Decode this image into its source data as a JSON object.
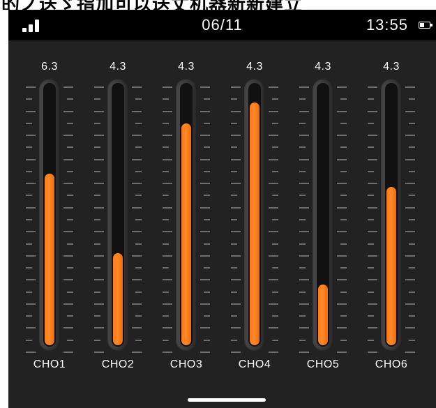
{
  "banner": {
    "text": "的ノ送ゞ指加可以送丈机器新新建立"
  },
  "status_bar": {
    "date": "06/11",
    "time": "13:55",
    "signal_icon": "signal-bars-icon",
    "battery_icon": "battery-icon"
  },
  "colors": {
    "background": "#222222",
    "status_bar": "#000000",
    "accent": "#ff7a1a",
    "text": "#ffffff"
  },
  "channels": [
    {
      "label": "CHO1",
      "value": "6.3",
      "level": 0.65
    },
    {
      "label": "CHO2",
      "value": "4.3",
      "level": 0.35
    },
    {
      "label": "CHO3",
      "value": "4.3",
      "level": 0.84
    },
    {
      "label": "CHO4",
      "value": "4.3",
      "level": 0.92
    },
    {
      "label": "CHO5",
      "value": "4.3",
      "level": 0.23
    },
    {
      "label": "CHO6",
      "value": "4.3",
      "level": 0.6
    }
  ]
}
